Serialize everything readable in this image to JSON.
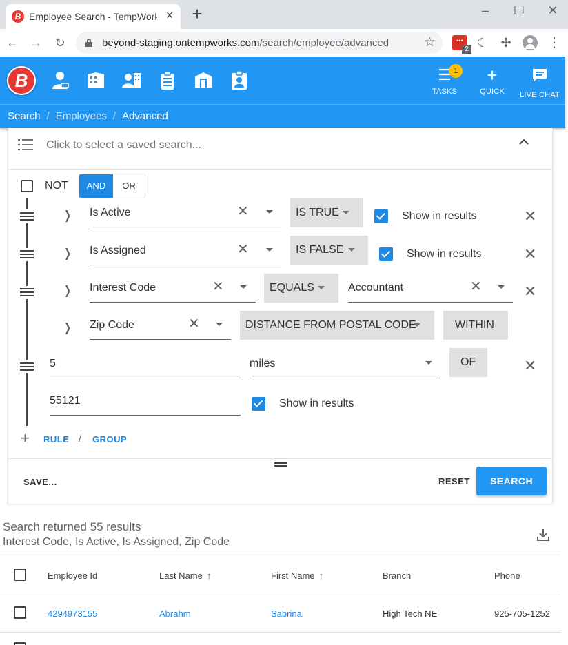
{
  "browser": {
    "tab_title": "Employee Search - TempWorks B",
    "url_host": "beyond-staging.ontempworks.com",
    "url_path": "/search/employee/advanced",
    "extension_badge": "2"
  },
  "header": {
    "logo_letter": "B",
    "tasks_label": "TASKS",
    "tasks_badge": "1",
    "quick_label": "QUICK",
    "livechat_label": "LIVE CHAT",
    "breadcrumb": [
      "Search",
      "Employees",
      "Advanced"
    ],
    "brand_color": "#2196f3"
  },
  "saved_search": {
    "placeholder": "Click to select a saved search..."
  },
  "builder": {
    "not_label": "NOT",
    "and_label": "AND",
    "or_label": "OR",
    "rules": [
      {
        "field": "Is Active",
        "operator": "IS TRUE",
        "show_label": "Show in results"
      },
      {
        "field": "Is Assigned",
        "operator": "IS FALSE",
        "show_label": "Show in results"
      },
      {
        "field": "Interest Code",
        "operator": "EQUALS",
        "value": "Accountant"
      },
      {
        "field": "Zip Code",
        "operator": "DISTANCE FROM POSTAL CODE",
        "within_label": "WITHIN",
        "distance": "5",
        "unit": "miles",
        "of_label": "OF",
        "postal_code": "55121",
        "show_label": "Show in results"
      }
    ],
    "add_rule": "RULE",
    "add_group": "GROUP",
    "save_label": "SAVE...",
    "reset_label": "RESET",
    "search_label": "SEARCH"
  },
  "results": {
    "title": "Search returned 55 results",
    "subtitle": "Interest Code, Is Active, Is Assigned, Zip Code",
    "columns": [
      "Employee Id",
      "Last Name",
      "First Name",
      "Branch",
      "Phone"
    ],
    "rows": [
      {
        "employee_id": "4294973155",
        "last_name": "Abrahm",
        "first_name": "Sabrina",
        "branch": "High Tech NE",
        "phone": "925-705-1252"
      }
    ]
  }
}
